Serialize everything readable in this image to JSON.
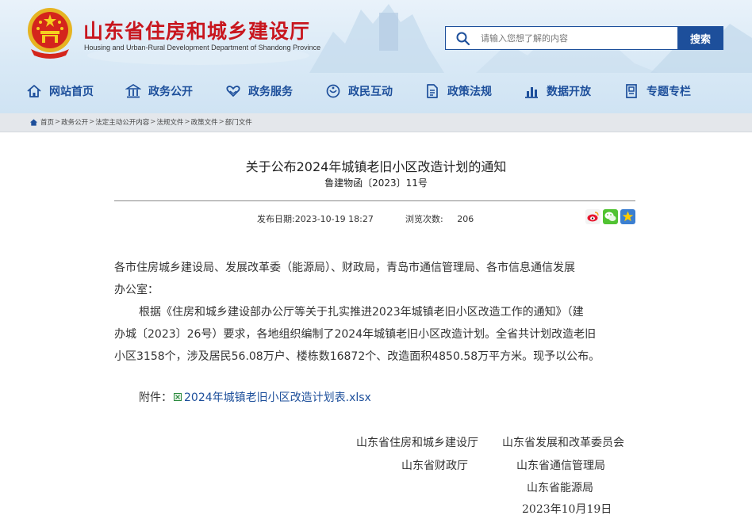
{
  "header": {
    "title": "山东省住房和城乡建设厅",
    "subtitle": "Housing and Urban-Rural Development Department of Shandong Province",
    "emblem_icon": "national-emblem-icon",
    "search": {
      "placeholder": "请输入您想了解的内容",
      "button": "搜索",
      "icon": "search-icon"
    }
  },
  "nav": {
    "items": [
      {
        "label": "网站首页",
        "icon": "home-icon"
      },
      {
        "label": "政务公开",
        "icon": "building-icon"
      },
      {
        "label": "政务服务",
        "icon": "heart-hands-icon"
      },
      {
        "label": "政民互动",
        "icon": "chat-icon"
      },
      {
        "label": "政策法规",
        "icon": "document-icon"
      },
      {
        "label": "数据开放",
        "icon": "bar-chart-icon"
      },
      {
        "label": "专题专栏",
        "icon": "topic-icon"
      }
    ]
  },
  "breadcrumb": {
    "items": [
      "首页",
      "政务公开",
      "法定主动公开内容",
      "法规文件",
      "政策文件",
      "部门文件"
    ],
    "separator": ">"
  },
  "article": {
    "title": "关于公布2024年城镇老旧小区改造计划的通知",
    "doc_number": "鲁建物函〔2023〕11号",
    "publish_label": "发布日期:",
    "publish_date": "2023-10-19 18:27",
    "views_label": "浏览次数:",
    "views": "206",
    "share_icons": [
      "weibo-icon",
      "wechat-icon",
      "favorite-star-icon"
    ],
    "recipients_line1": "各市住房城乡建设局、发展改革委（能源局）、财政局，青岛市通信管理局、各市信息通信发展",
    "recipients_line2": "办公室：",
    "body_line1": "根据《住房和城乡建设部办公厅等关于扎实推进2023年城镇老旧小区改造工作的通知》（建",
    "body_line2": "办城〔2023〕26号）要求，各地组织编制了2024年城镇老旧小区改造计划。全省共计划改造老旧",
    "body_line3": "小区3158个，涉及居民56.08万户、楼栋数16872个、改造面积4850.58万平方米。现予以公布。",
    "attachment_label": "附件：",
    "attachment_name": "2024年城镇老旧小区改造计划表.xlsx",
    "signatures": {
      "org1": "山东省住房和城乡建设厅",
      "org2": "山东省发展和改革委员会",
      "org3": "山东省财政厅",
      "org4": "山东省通信管理局",
      "org5": "山东省能源局",
      "date": "2023年10月19日"
    }
  },
  "colors": {
    "brand_red": "#c8161e",
    "nav_blue": "#1d4f9b",
    "link_blue": "#1d4f9b"
  }
}
